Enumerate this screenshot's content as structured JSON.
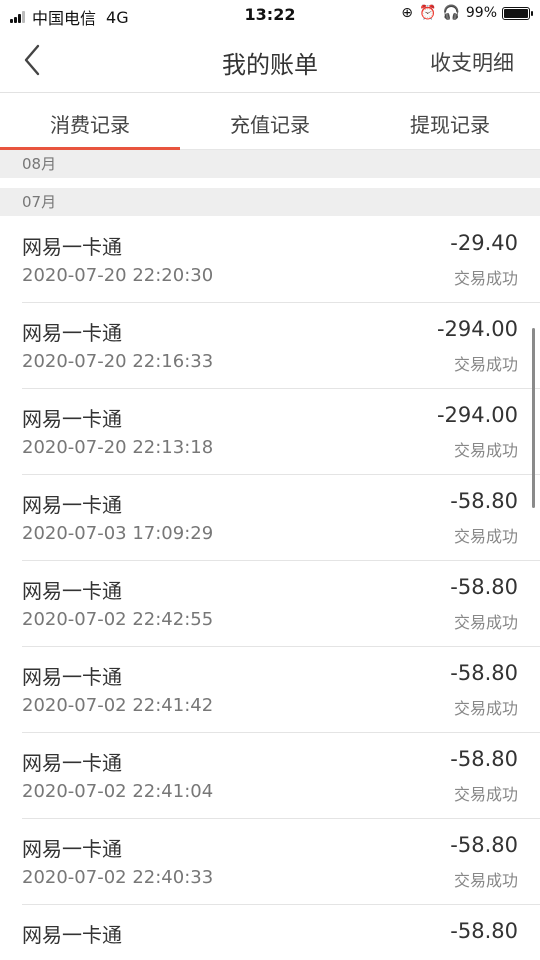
{
  "status_bar": {
    "carrier": "中国电信",
    "network": "4G",
    "time": "13:22",
    "battery": "99%",
    "battery_level": 0.99
  },
  "nav": {
    "title": "我的账单",
    "action": "收支明细"
  },
  "tabs": [
    {
      "label": "消费记录",
      "active": true
    },
    {
      "label": "充值记录",
      "active": false
    },
    {
      "label": "提现记录",
      "active": false
    }
  ],
  "months": [
    {
      "label": "08月"
    },
    {
      "label": "07月"
    }
  ],
  "records": [
    {
      "name": "网易一卡通",
      "time": "2020-07-20 22:20:30",
      "amount": "-29.40",
      "status": "交易成功"
    },
    {
      "name": "网易一卡通",
      "time": "2020-07-20 22:16:33",
      "amount": "-294.00",
      "status": "交易成功"
    },
    {
      "name": "网易一卡通",
      "time": "2020-07-20 22:13:18",
      "amount": "-294.00",
      "status": "交易成功"
    },
    {
      "name": "网易一卡通",
      "time": "2020-07-03 17:09:29",
      "amount": "-58.80",
      "status": "交易成功"
    },
    {
      "name": "网易一卡通",
      "time": "2020-07-02 22:42:55",
      "amount": "-58.80",
      "status": "交易成功"
    },
    {
      "name": "网易一卡通",
      "time": "2020-07-02 22:41:42",
      "amount": "-58.80",
      "status": "交易成功"
    },
    {
      "name": "网易一卡通",
      "time": "2020-07-02 22:41:04",
      "amount": "-58.80",
      "status": "交易成功"
    },
    {
      "name": "网易一卡通",
      "time": "2020-07-02 22:40:33",
      "amount": "-58.80",
      "status": "交易成功"
    },
    {
      "name": "网易一卡通",
      "time": "",
      "amount": "-58.80",
      "status": ""
    }
  ],
  "colors": {
    "accent": "#e8543e",
    "month_bg": "#eeeeee"
  }
}
